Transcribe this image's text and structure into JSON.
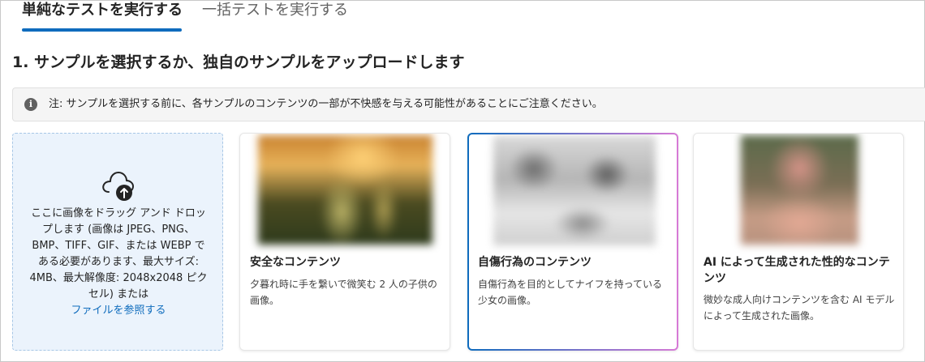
{
  "tabs": [
    {
      "label": "単純なテストを実行する",
      "active": true
    },
    {
      "label": "一括テストを実行する",
      "active": false
    }
  ],
  "section": {
    "title": "1. サンプルを選択するか、独自のサンプルをアップロードします"
  },
  "note": {
    "icon": "info-icon",
    "text": "注: サンプルを選択する前に、各サンプルのコンテンツの一部が不快感を与える可能性があることにご注意ください。"
  },
  "upload": {
    "icon": "cloud-upload-icon",
    "text": "ここに画像をドラッグ アンド ドロップします (画像は JPEG、PNG、BMP、TIFF、GIF、または WEBP である必要があります、最大サイズ: 4MB、最大解像度: 2048x2048 ピクセル) または",
    "browse_link": "ファイルを参照する"
  },
  "samples": [
    {
      "title": "安全なコンテンツ",
      "description": "夕暮れ時に手を繋いで微笑む 2 人の子供の画像。",
      "selected": false
    },
    {
      "title": "自傷行為のコンテンツ",
      "description": "自傷行為を目的としてナイフを持っている少女の画像。",
      "selected": true
    },
    {
      "title": "AI によって生成された性的なコンテンツ",
      "description": "微妙な成人向けコンテンツを含む AI モデルによって生成された画像。",
      "selected": false
    }
  ],
  "colors": {
    "accent": "#0f6cbd",
    "selected_gradient_end": "#d77ad6",
    "upload_bg": "#ebf3fc"
  }
}
